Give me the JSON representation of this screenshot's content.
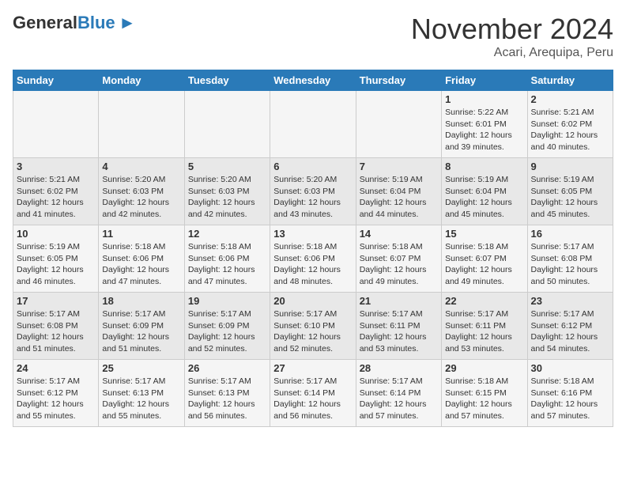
{
  "header": {
    "logo": {
      "general": "General",
      "blue": "Blue"
    },
    "month": "November 2024",
    "location": "Acari, Arequipa, Peru"
  },
  "weekdays": [
    "Sunday",
    "Monday",
    "Tuesday",
    "Wednesday",
    "Thursday",
    "Friday",
    "Saturday"
  ],
  "weeks": [
    [
      {
        "day": "",
        "info": ""
      },
      {
        "day": "",
        "info": ""
      },
      {
        "day": "",
        "info": ""
      },
      {
        "day": "",
        "info": ""
      },
      {
        "day": "",
        "info": ""
      },
      {
        "day": "1",
        "info": "Sunrise: 5:22 AM\nSunset: 6:01 PM\nDaylight: 12 hours\nand 39 minutes."
      },
      {
        "day": "2",
        "info": "Sunrise: 5:21 AM\nSunset: 6:02 PM\nDaylight: 12 hours\nand 40 minutes."
      }
    ],
    [
      {
        "day": "3",
        "info": "Sunrise: 5:21 AM\nSunset: 6:02 PM\nDaylight: 12 hours\nand 41 minutes."
      },
      {
        "day": "4",
        "info": "Sunrise: 5:20 AM\nSunset: 6:03 PM\nDaylight: 12 hours\nand 42 minutes."
      },
      {
        "day": "5",
        "info": "Sunrise: 5:20 AM\nSunset: 6:03 PM\nDaylight: 12 hours\nand 42 minutes."
      },
      {
        "day": "6",
        "info": "Sunrise: 5:20 AM\nSunset: 6:03 PM\nDaylight: 12 hours\nand 43 minutes."
      },
      {
        "day": "7",
        "info": "Sunrise: 5:19 AM\nSunset: 6:04 PM\nDaylight: 12 hours\nand 44 minutes."
      },
      {
        "day": "8",
        "info": "Sunrise: 5:19 AM\nSunset: 6:04 PM\nDaylight: 12 hours\nand 45 minutes."
      },
      {
        "day": "9",
        "info": "Sunrise: 5:19 AM\nSunset: 6:05 PM\nDaylight: 12 hours\nand 45 minutes."
      }
    ],
    [
      {
        "day": "10",
        "info": "Sunrise: 5:19 AM\nSunset: 6:05 PM\nDaylight: 12 hours\nand 46 minutes."
      },
      {
        "day": "11",
        "info": "Sunrise: 5:18 AM\nSunset: 6:06 PM\nDaylight: 12 hours\nand 47 minutes."
      },
      {
        "day": "12",
        "info": "Sunrise: 5:18 AM\nSunset: 6:06 PM\nDaylight: 12 hours\nand 47 minutes."
      },
      {
        "day": "13",
        "info": "Sunrise: 5:18 AM\nSunset: 6:06 PM\nDaylight: 12 hours\nand 48 minutes."
      },
      {
        "day": "14",
        "info": "Sunrise: 5:18 AM\nSunset: 6:07 PM\nDaylight: 12 hours\nand 49 minutes."
      },
      {
        "day": "15",
        "info": "Sunrise: 5:18 AM\nSunset: 6:07 PM\nDaylight: 12 hours\nand 49 minutes."
      },
      {
        "day": "16",
        "info": "Sunrise: 5:17 AM\nSunset: 6:08 PM\nDaylight: 12 hours\nand 50 minutes."
      }
    ],
    [
      {
        "day": "17",
        "info": "Sunrise: 5:17 AM\nSunset: 6:08 PM\nDaylight: 12 hours\nand 51 minutes."
      },
      {
        "day": "18",
        "info": "Sunrise: 5:17 AM\nSunset: 6:09 PM\nDaylight: 12 hours\nand 51 minutes."
      },
      {
        "day": "19",
        "info": "Sunrise: 5:17 AM\nSunset: 6:09 PM\nDaylight: 12 hours\nand 52 minutes."
      },
      {
        "day": "20",
        "info": "Sunrise: 5:17 AM\nSunset: 6:10 PM\nDaylight: 12 hours\nand 52 minutes."
      },
      {
        "day": "21",
        "info": "Sunrise: 5:17 AM\nSunset: 6:11 PM\nDaylight: 12 hours\nand 53 minutes."
      },
      {
        "day": "22",
        "info": "Sunrise: 5:17 AM\nSunset: 6:11 PM\nDaylight: 12 hours\nand 53 minutes."
      },
      {
        "day": "23",
        "info": "Sunrise: 5:17 AM\nSunset: 6:12 PM\nDaylight: 12 hours\nand 54 minutes."
      }
    ],
    [
      {
        "day": "24",
        "info": "Sunrise: 5:17 AM\nSunset: 6:12 PM\nDaylight: 12 hours\nand 55 minutes."
      },
      {
        "day": "25",
        "info": "Sunrise: 5:17 AM\nSunset: 6:13 PM\nDaylight: 12 hours\nand 55 minutes."
      },
      {
        "day": "26",
        "info": "Sunrise: 5:17 AM\nSunset: 6:13 PM\nDaylight: 12 hours\nand 56 minutes."
      },
      {
        "day": "27",
        "info": "Sunrise: 5:17 AM\nSunset: 6:14 PM\nDaylight: 12 hours\nand 56 minutes."
      },
      {
        "day": "28",
        "info": "Sunrise: 5:17 AM\nSunset: 6:14 PM\nDaylight: 12 hours\nand 57 minutes."
      },
      {
        "day": "29",
        "info": "Sunrise: 5:18 AM\nSunset: 6:15 PM\nDaylight: 12 hours\nand 57 minutes."
      },
      {
        "day": "30",
        "info": "Sunrise: 5:18 AM\nSunset: 6:16 PM\nDaylight: 12 hours\nand 57 minutes."
      }
    ]
  ]
}
